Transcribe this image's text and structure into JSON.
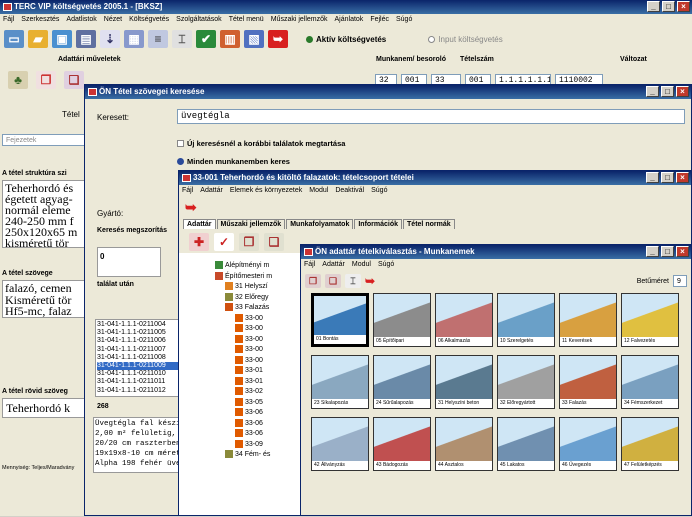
{
  "main_window": {
    "title": "TERC VIP költségvetés 2005.1 - [BKSZ]",
    "menu": [
      "Fájl",
      "Szerkesztés",
      "Adatlistok",
      "Nézet",
      "Költségvetés",
      "Szolgáltatások",
      "Tétel menü",
      "Műszaki jellemzők",
      "Ajánlatok",
      "Fejléc",
      "Súgó"
    ],
    "radio_active": "Aktív költségvetés",
    "radio_input": "Input költségvetés",
    "section_ops": "Adattári műveletek",
    "header_munkanem": "Munkanem/ besoroló",
    "header_tetelszam": "Tételszám",
    "header_valtozat": "Változat",
    "code_parts": [
      "32",
      "001",
      "33",
      "001",
      "1.1.1.1.1.1.1",
      "1110002"
    ],
    "tetel_label": "Tétel",
    "fejezetek_placeholder": "Fejezetek",
    "struct_label": "A tétel struktúra szi",
    "long_text_lines": [
      "Teherhordó és",
      "égetett agyag-",
      "normál eleme",
      "240-250 mm f",
      "250x120x65 m",
      "kisméretű tör"
    ],
    "tetel_szovege_label": "A tétel szövege",
    "tetel_szovege_lines": [
      "falazó, cemen",
      "Kisméretű tör",
      "Hf5-mc, falaz"
    ],
    "short_text_label": "A tétel rövid szöveg",
    "short_text": "Teherhordó k",
    "footer_label": "Mennyiség: Teljes/Maradvány"
  },
  "search_window": {
    "title": "ÖN Tétel szövegei keresése",
    "kereses_label": "Keresett:",
    "kereses_value": "üvegtégla",
    "checkbox_label": "Új keresésnél a korábbi találatok megtartása",
    "radio_label": "Minden munkanemben keres",
    "gyarto_label": "Gyártó:",
    "megszoritas_label": "Keresés megszorítás",
    "count_value": "0",
    "talalat_label": "találat után",
    "codes": [
      "31-041-1.1.1-0211004",
      "31-041-1.1.1-0211005",
      "31-041-1.1.1-0211006",
      "31-041-1.1.1-0211007",
      "31-041-1.1.1-0211008",
      "31-041-1.1.1-0211009",
      "31-041-1.1.1-0211010",
      "31-041-1.1.1-0211011",
      "31-041-1.1.1-0211012"
    ],
    "selected_index": 5,
    "result_count": "268",
    "desc_lines": [
      "Üvegtégla fal készít",
      "2,00 m² felületig,",
      "20/20 cm raszterben",
      "19x19x8-10 cm méret",
      "Alpha 198 fehér üveg"
    ]
  },
  "tree_window": {
    "title": "33-001 Teherhordó és kitöltő falazatok: tételcsoport tételei",
    "menu": [
      "Fájl",
      "Adattár",
      "Elemek és környezetek",
      "Modul",
      "Deaktivál",
      "Súgó"
    ],
    "tabs": [
      "Adattár",
      "Műszaki jellemzők",
      "Munkafolyamatok",
      "Információk",
      "Tétel normák"
    ],
    "tree": [
      {
        "label": "Alépítményi m",
        "indent": 0
      },
      {
        "label": "Építőmesteri m",
        "indent": 0
      },
      {
        "label": "31 Helyszí",
        "indent": 1
      },
      {
        "label": "32 Előregy",
        "indent": 1
      },
      {
        "label": "33 Falazás",
        "indent": 1
      },
      {
        "label": "33-00",
        "indent": 2
      },
      {
        "label": "33-00",
        "indent": 2
      },
      {
        "label": "33-00",
        "indent": 2
      },
      {
        "label": "33-00",
        "indent": 2
      },
      {
        "label": "33-00",
        "indent": 2
      },
      {
        "label": "33-01",
        "indent": 2
      },
      {
        "label": "33-01",
        "indent": 2
      },
      {
        "label": "33-02",
        "indent": 2
      },
      {
        "label": "33-05",
        "indent": 2
      },
      {
        "label": "33-06",
        "indent": 2
      },
      {
        "label": "33-06",
        "indent": 2
      },
      {
        "label": "33-06",
        "indent": 2
      },
      {
        "label": "33-09",
        "indent": 2
      },
      {
        "label": "34 Fém- és",
        "indent": 1
      }
    ]
  },
  "catalog_window": {
    "title": "ÖN adattár tételkiválasztás - Munkanemek",
    "menu": [
      "Fájl",
      "Adattár",
      "Modul",
      "Súgó"
    ],
    "size_label": "Betűméret",
    "size_value": "9",
    "tiles": [
      {
        "label": "01 Bontás",
        "color": "#3a7ab8"
      },
      {
        "label": "05 Építőipari",
        "color": "#8c8c8c"
      },
      {
        "label": "06 Alkalmazás",
        "color": "#c07070"
      },
      {
        "label": "10 Szerelgetés",
        "color": "#6aa0c8"
      },
      {
        "label": "11 Keverések",
        "color": "#d8a040"
      },
      {
        "label": "12 Falvezetés",
        "color": "#e0c040"
      },
      {
        "label": "23 Síkalapozás",
        "color": "#8aa8c0"
      },
      {
        "label": "24 Sűrűalapozás",
        "color": "#6a8aa8"
      },
      {
        "label": "31 Helyszíni beton",
        "color": "#5a7a90"
      },
      {
        "label": "32 Előregyártott",
        "color": "#a0a0a0"
      },
      {
        "label": "33 Falazás",
        "color": "#c06040"
      },
      {
        "label": "34 Fémszerkezet",
        "color": "#7aa0c0"
      },
      {
        "label": "42 Állványzás",
        "color": "#9ab0c8"
      },
      {
        "label": "43 Bádogozás",
        "color": "#c05050"
      },
      {
        "label": "44 Asztalos",
        "color": "#b09070"
      },
      {
        "label": "45 Lakatos",
        "color": "#7090b0"
      },
      {
        "label": "46 Üvegezés",
        "color": "#6aa0d0"
      },
      {
        "label": "47 Felületképzés",
        "color": "#d0b040"
      }
    ]
  }
}
